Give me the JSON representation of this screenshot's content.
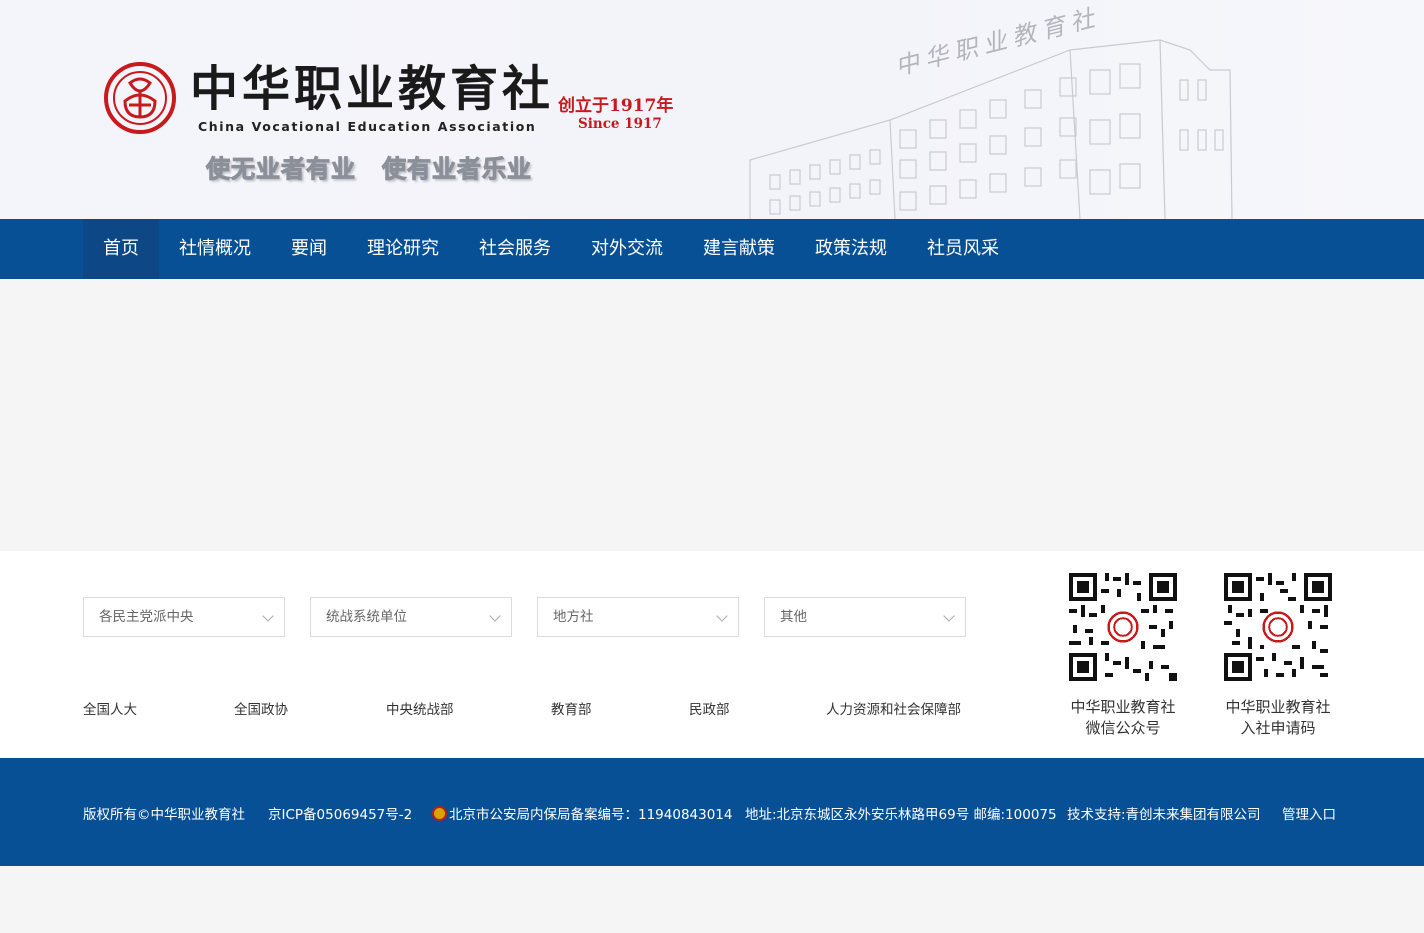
{
  "header": {
    "title_cn": "中华职业教育社",
    "title_en": "China Vocational Education Association",
    "since_cn": "创立于1917年",
    "since_en": "Since 1917",
    "slogans": [
      "使无业者有业",
      "使有业者乐业"
    ],
    "building_sign": "中华职业教育社"
  },
  "nav": {
    "items": [
      {
        "label": "首页"
      },
      {
        "label": "社情概况"
      },
      {
        "label": "要闻"
      },
      {
        "label": "理论研究"
      },
      {
        "label": "社会服务"
      },
      {
        "label": "对外交流"
      },
      {
        "label": "建言献策"
      },
      {
        "label": "政策法规"
      },
      {
        "label": "社员风采"
      }
    ]
  },
  "links": {
    "selects": [
      {
        "label": "各民主党派中央"
      },
      {
        "label": "统战系统单位"
      },
      {
        "label": "地方社"
      },
      {
        "label": "其他"
      }
    ],
    "friend_links": [
      "全国人大",
      "全国政协",
      "中央统战部",
      "教育部",
      "民政部",
      "人力资源和社会保障部"
    ],
    "qr_codes": [
      {
        "line1": "中华职业教育社",
        "line2": "微信公众号"
      },
      {
        "line1": "中华职业教育社",
        "line2": "入社申请码"
      }
    ]
  },
  "footer": {
    "copyright": "版权所有©中华职业教育社",
    "icp": "京ICP备05069457号-2",
    "police": "北京市公安局内保局备案编号：11940843014",
    "address": "地址:北京东城区永外安乐林路甲69号 邮编:100075",
    "tech": "技术支持:青创未来集团有限公司",
    "admin": "管理入口"
  },
  "colors": {
    "nav_bg": "#075096",
    "nav_active": "#0d4785",
    "brand_red": "#c8191d",
    "footer_bg": "#075096"
  }
}
